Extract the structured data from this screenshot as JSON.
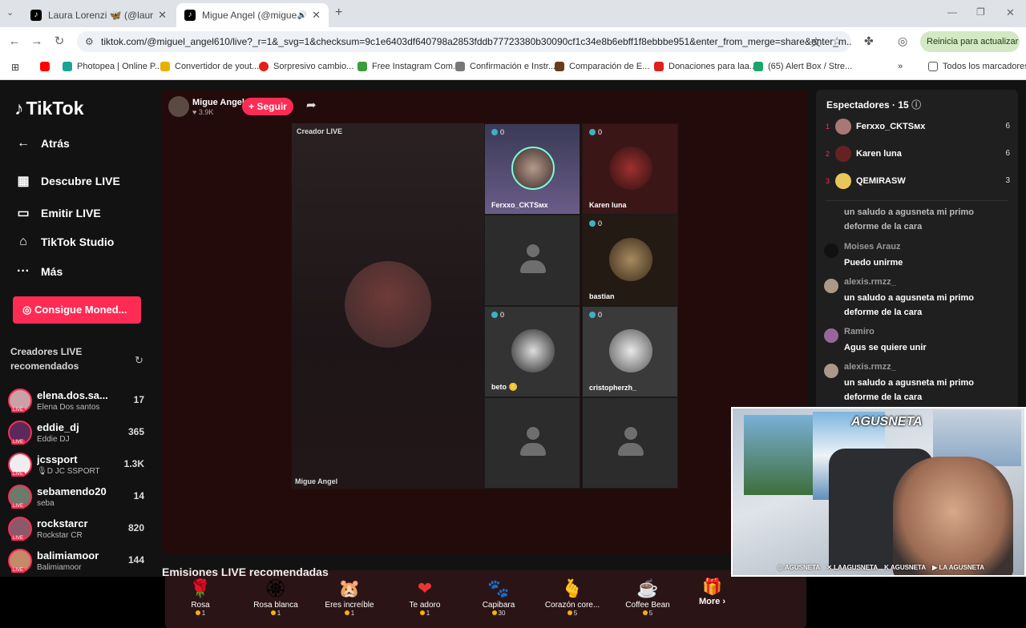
{
  "browser": {
    "tabs": [
      {
        "title": "Laura Lorenzi 🦋 (@laurita.bj)",
        "active": false
      },
      {
        "title": "Migue Angel (@miguel_ang",
        "active": true
      }
    ],
    "url": "tiktok.com/@miguel_angel610/live?_r=1&_svg=1&checksum=9c1e6403df640798a2853fddb77723380b30090cf1c34e8b6ebff1f8ebbbe951&enter_from_merge=share&enter_m...",
    "update_label": "Reinicia para actualizar",
    "bookmarks": [
      "Photopea | Online P...",
      "Convertidor de yout...",
      "Sorpresivo cambio...",
      "Free Instagram Com...",
      "Confirmación e Instr...",
      "Comparación de E...",
      "Donaciones para laa...",
      "(65) Alert Box / Stre..."
    ],
    "bookmarks_all": "Todos los marcadores"
  },
  "sidebar": {
    "logo": "TikTok",
    "nav": [
      {
        "label": "Atrás",
        "icon": "←"
      },
      {
        "label": "Descubre LIVE",
        "icon": "▦"
      },
      {
        "label": "Emitir LIVE",
        "icon": "▭"
      },
      {
        "label": "TikTok Studio",
        "icon": "⌂"
      },
      {
        "label": "Más",
        "icon": "···"
      }
    ],
    "coins_label": "Consigue Moned...",
    "rec_title": "Creadores LIVE recomendados",
    "creators": [
      {
        "user": "elena.dos.sa...",
        "name": "Elena Dos santos",
        "count": "17"
      },
      {
        "user": "eddie_dj",
        "name": "Eddie DJ",
        "count": "365"
      },
      {
        "user": "jcssport",
        "name": "🎙D JC SSPORT",
        "count": "1.3K"
      },
      {
        "user": "sebamendo20",
        "name": "seba",
        "count": "14"
      },
      {
        "user": "rockstarcr",
        "name": "Rockstar CR",
        "count": "820"
      },
      {
        "user": "balimiamoor",
        "name": "Balimiamoor",
        "count": "144"
      }
    ]
  },
  "stream": {
    "host_name": "Migue Angel",
    "host_likes": "3.9K",
    "follow_label": "+ Seguir",
    "creator_label": "Creador LIVE",
    "main_name": "Migue Angel",
    "guests": [
      {
        "name": "Ferxxo_CKTSᴍx",
        "count": "0"
      },
      {
        "name": "Karen luna",
        "count": "0"
      },
      {
        "name": "",
        "count": ""
      },
      {
        "name": "bastian",
        "count": "0"
      },
      {
        "name": "beto 🪙",
        "count": "0"
      },
      {
        "name": "cristopherzh_",
        "count": "0"
      },
      {
        "name": "",
        "count": ""
      },
      {
        "name": "",
        "count": ""
      }
    ]
  },
  "gifts": [
    {
      "name": "Rosa",
      "price": "1",
      "icon": "🌹"
    },
    {
      "name": "Rosa blanca",
      "price": "1",
      "icon": "🏵"
    },
    {
      "name": "Eres increíble",
      "price": "1",
      "icon": "🐹"
    },
    {
      "name": "Te adoro",
      "price": "1",
      "icon": "❤"
    },
    {
      "name": "Capibara",
      "price": "30",
      "icon": "🐾"
    },
    {
      "name": "Corazón core...",
      "price": "5",
      "icon": "🫰"
    },
    {
      "name": "Coffee Bean",
      "price": "5",
      "icon": "☕"
    }
  ],
  "more_label": "More ›",
  "recommended_title": "Emisiones LIVE recomendadas",
  "viewers_panel": {
    "title": "Espectadores · 15",
    "viewers": [
      {
        "rank": "1",
        "name": "Ferxxo_CKTSᴍx",
        "score": "6"
      },
      {
        "rank": "2",
        "name": "Karen luna",
        "score": "6"
      },
      {
        "rank": "3",
        "name": "QEMIRASW",
        "score": "3"
      }
    ],
    "chat": [
      {
        "user": "",
        "msg": "un saludo a agusneta mi primo deforme de la cara"
      },
      {
        "user": "Moises Arauz",
        "msg": "Puedo unirme"
      },
      {
        "user": "alexis.rmzz_",
        "msg": "un saludo a agusneta mi primo deforme de la cara"
      },
      {
        "user": "Ramiro",
        "msg": "Agus se quiere unir"
      },
      {
        "user": "alexis.rmzz_",
        "msg": "un saludo a agusneta mi primo deforme de la cara"
      }
    ]
  },
  "webcam": {
    "logo": "AGUSNETA",
    "socials": [
      "AGUSNETA",
      "LAAGUSNETA",
      "AGUSNETA",
      "LA AGUSNETA"
    ]
  },
  "colors": {
    "accent": "#fe2c55",
    "page_bg": "#121212",
    "stream_bg": "#240b0b"
  }
}
